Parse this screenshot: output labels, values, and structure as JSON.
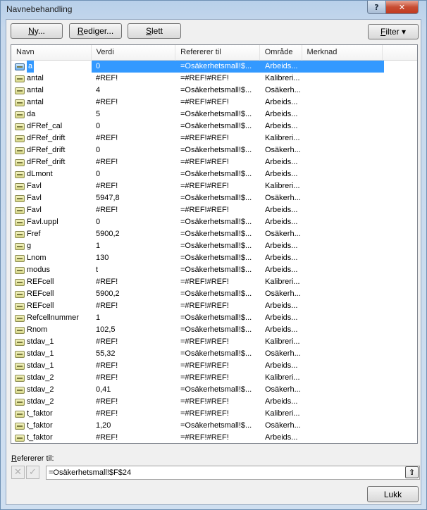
{
  "window": {
    "title": "Navnebehandling",
    "help_label": "?",
    "close_label": "✕"
  },
  "toolbar": {
    "new_label_u": "N",
    "new_label_rest": "y...",
    "edit_label_u": "R",
    "edit_label_rest": "ediger...",
    "delete_label_u": "S",
    "delete_label_rest": "lett",
    "filter_label_u": "F",
    "filter_label_rest": "ilter ▾"
  },
  "columns": [
    "Navn",
    "Verdi",
    "Refererer til",
    "Område",
    "Merknad"
  ],
  "rows": [
    {
      "name": "a",
      "value": "0",
      "ref": "=Osäkerhetsmall!$...",
      "scope": "Arbeids...",
      "selected": true
    },
    {
      "name": "antal",
      "value": "#REF!",
      "ref": "=#REF!#REF!",
      "scope": "Kalibreri..."
    },
    {
      "name": "antal",
      "value": "4",
      "ref": "=Osäkerhetsmall!$...",
      "scope": "Osäkerh..."
    },
    {
      "name": "antal",
      "value": "#REF!",
      "ref": "=#REF!#REF!",
      "scope": "Arbeids..."
    },
    {
      "name": "da",
      "value": "5",
      "ref": "=Osäkerhetsmall!$...",
      "scope": "Arbeids..."
    },
    {
      "name": "dFRef_cal",
      "value": "0",
      "ref": "=Osäkerhetsmall!$...",
      "scope": "Arbeids..."
    },
    {
      "name": "dFRef_drift",
      "value": "#REF!",
      "ref": "=#REF!#REF!",
      "scope": "Kalibreri..."
    },
    {
      "name": "dFRef_drift",
      "value": "0",
      "ref": "=Osäkerhetsmall!$...",
      "scope": "Osäkerh..."
    },
    {
      "name": "dFRef_drift",
      "value": "#REF!",
      "ref": "=#REF!#REF!",
      "scope": "Arbeids..."
    },
    {
      "name": "dLmont",
      "value": "0",
      "ref": "=Osäkerhetsmall!$...",
      "scope": "Arbeids..."
    },
    {
      "name": "Favl",
      "value": "#REF!",
      "ref": "=#REF!#REF!",
      "scope": "Kalibreri..."
    },
    {
      "name": "Favl",
      "value": "5947,8",
      "ref": "=Osäkerhetsmall!$...",
      "scope": "Osäkerh..."
    },
    {
      "name": "Favl",
      "value": "#REF!",
      "ref": "=#REF!#REF!",
      "scope": "Arbeids..."
    },
    {
      "name": "Favl.uppl",
      "value": "0",
      "ref": "=Osäkerhetsmall!$...",
      "scope": "Arbeids..."
    },
    {
      "name": "Fref",
      "value": "5900,2",
      "ref": "=Osäkerhetsmall!$...",
      "scope": "Osäkerh..."
    },
    {
      "name": "g",
      "value": "1",
      "ref": "=Osäkerhetsmall!$...",
      "scope": "Arbeids..."
    },
    {
      "name": "Lnom",
      "value": "130",
      "ref": "=Osäkerhetsmall!$...",
      "scope": "Arbeids..."
    },
    {
      "name": "modus",
      "value": "t",
      "ref": "=Osäkerhetsmall!$...",
      "scope": "Arbeids..."
    },
    {
      "name": "REFcell",
      "value": "#REF!",
      "ref": "=#REF!#REF!",
      "scope": "Kalibreri..."
    },
    {
      "name": "REFcell",
      "value": "5900,2",
      "ref": "=Osäkerhetsmall!$...",
      "scope": "Osäkerh..."
    },
    {
      "name": "REFcell",
      "value": "#REF!",
      "ref": "=#REF!#REF!",
      "scope": "Arbeids..."
    },
    {
      "name": "Refcellnummer",
      "value": "1",
      "ref": "=Osäkerhetsmall!$...",
      "scope": "Arbeids..."
    },
    {
      "name": "Rnom",
      "value": "102,5",
      "ref": "=Osäkerhetsmall!$...",
      "scope": "Arbeids..."
    },
    {
      "name": "stdav_1",
      "value": "#REF!",
      "ref": "=#REF!#REF!",
      "scope": "Kalibreri..."
    },
    {
      "name": "stdav_1",
      "value": "55,32",
      "ref": "=Osäkerhetsmall!$...",
      "scope": "Osäkerh..."
    },
    {
      "name": "stdav_1",
      "value": "#REF!",
      "ref": "=#REF!#REF!",
      "scope": "Arbeids..."
    },
    {
      "name": "stdav_2",
      "value": "#REF!",
      "ref": "=#REF!#REF!",
      "scope": "Kalibreri..."
    },
    {
      "name": "stdav_2",
      "value": "0,41",
      "ref": "=Osäkerhetsmall!$...",
      "scope": "Osäkerh..."
    },
    {
      "name": "stdav_2",
      "value": "#REF!",
      "ref": "=#REF!#REF!",
      "scope": "Arbeids..."
    },
    {
      "name": "t_faktor",
      "value": "#REF!",
      "ref": "=#REF!#REF!",
      "scope": "Kalibreri..."
    },
    {
      "name": "t_faktor",
      "value": "1,20",
      "ref": "=Osäkerhetsmall!$...",
      "scope": "Osäkerh..."
    },
    {
      "name": "t_faktor",
      "value": "#REF!",
      "ref": "=#REF!#REF!",
      "scope": "Arbeids..."
    }
  ],
  "refers_to": {
    "label_u": "R",
    "label_rest": "efererer til:",
    "value": "=Osäkerhetsmall!$F$24",
    "cancel_icon": "✕",
    "confirm_icon": "✓",
    "collapse_icon": "⇧"
  },
  "footer": {
    "close_label": "Lukk"
  },
  "icons": {
    "name_row": "name-range-icon"
  }
}
